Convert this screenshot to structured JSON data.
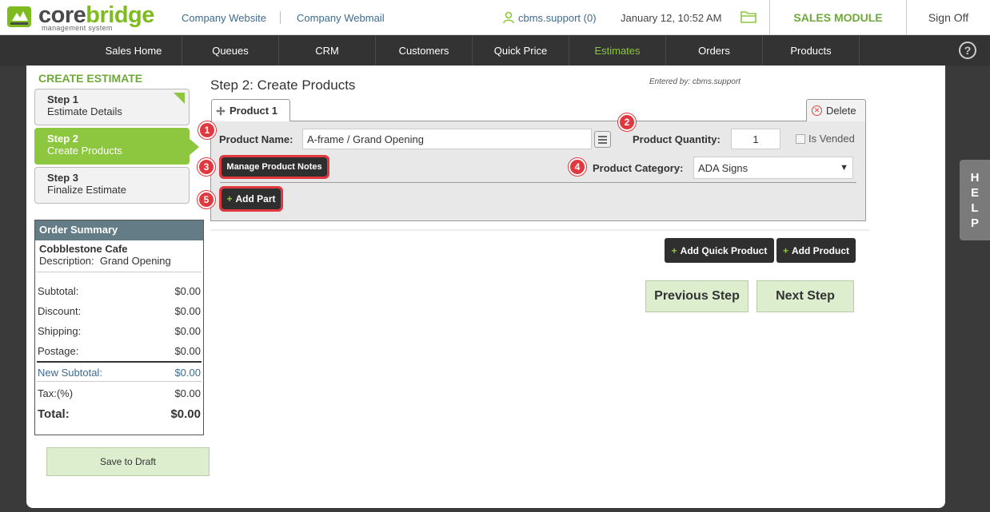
{
  "header": {
    "logo_main_1": "core",
    "logo_main_2": "bridge",
    "logo_sub": "management system",
    "company_website": "Company Website",
    "company_webmail": "Company Webmail",
    "user": "cbms.support (0)",
    "datetime": "January 12, 10:52 AM",
    "sales_module": "SALES MODULE",
    "sign_off": "Sign Off"
  },
  "nav": {
    "items": [
      "Sales Home",
      "Queues",
      "CRM",
      "Customers",
      "Quick Price",
      "Estimates",
      "Orders",
      "Products"
    ],
    "active": "Estimates",
    "help": "?"
  },
  "sidebar": {
    "title": "CREATE ESTIMATE",
    "steps": [
      {
        "title": "Step 1",
        "subtitle": "Estimate Details"
      },
      {
        "title": "Step 2",
        "subtitle": "Create Products"
      },
      {
        "title": "Step 3",
        "subtitle": "Finalize Estimate"
      }
    ],
    "save_draft": "Save to Draft"
  },
  "order_summary": {
    "heading": "Order Summary",
    "customer": "Cobblestone Cafe",
    "description_label": "Description:",
    "description": "Grand Opening",
    "rows": [
      {
        "label": "Subtotal:",
        "value": "$0.00"
      },
      {
        "label": "Discount:",
        "value": "$0.00"
      },
      {
        "label": "Shipping:",
        "value": "$0.00"
      },
      {
        "label": "Postage:",
        "value": "$0.00"
      },
      {
        "label": "New Subtotal:",
        "value": "$0.00"
      },
      {
        "label": "Tax:(%)",
        "value": "$0.00"
      },
      {
        "label": "Total:",
        "value": "$0.00"
      }
    ]
  },
  "main": {
    "step_title": "Step 2: Create Products",
    "entered_by": "Entered by: cbms.support",
    "product_tab": "Product 1",
    "delete": "Delete",
    "product_name_label": "Product Name:",
    "product_name_value": "A-frame / Grand Opening",
    "product_quantity_label": "Product Quantity:",
    "product_quantity_value": "1",
    "is_vended": "Is Vended",
    "manage_notes": "Manage Product Notes",
    "product_category_label": "Product Category:",
    "product_category_value": "ADA Signs",
    "add_part": "Add Part",
    "add_quick_product": "Add Quick Product",
    "add_product": "Add Product",
    "previous_step": "Previous Step",
    "next_step": "Next Step"
  },
  "badges": [
    "1",
    "2",
    "3",
    "4",
    "5"
  ],
  "help_tab": [
    "H",
    "E",
    "L",
    "P"
  ],
  "colors": {
    "accent": "#8dc63f",
    "link": "#3d6b8e",
    "badge": "#e0383e",
    "summary_header": "#637c86"
  }
}
